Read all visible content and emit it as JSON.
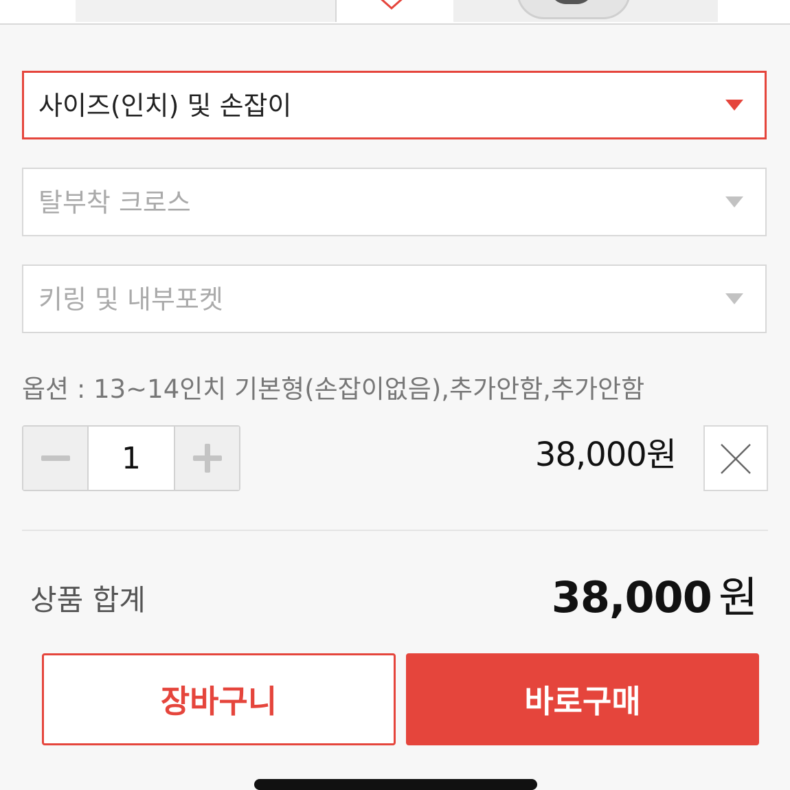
{
  "options": {
    "size_select": {
      "label": "사이즈(인치) 및 손잡이"
    },
    "cross_select": {
      "label": "탈부착 크로스"
    },
    "keyring_select": {
      "label": "키링 및 내부포켓"
    }
  },
  "selected_option": {
    "text": "옵션 : 13~14인치 기본형(손잡이없음),추가안함,추가안함",
    "quantity": "1",
    "price": "38,000원"
  },
  "total": {
    "label": "상품 합계",
    "amount": "38,000",
    "currency": "원"
  },
  "actions": {
    "cart_label": "장바구니",
    "buy_label": "바로구매"
  },
  "colors": {
    "accent": "#e5453c",
    "background": "#f7f7f7"
  }
}
